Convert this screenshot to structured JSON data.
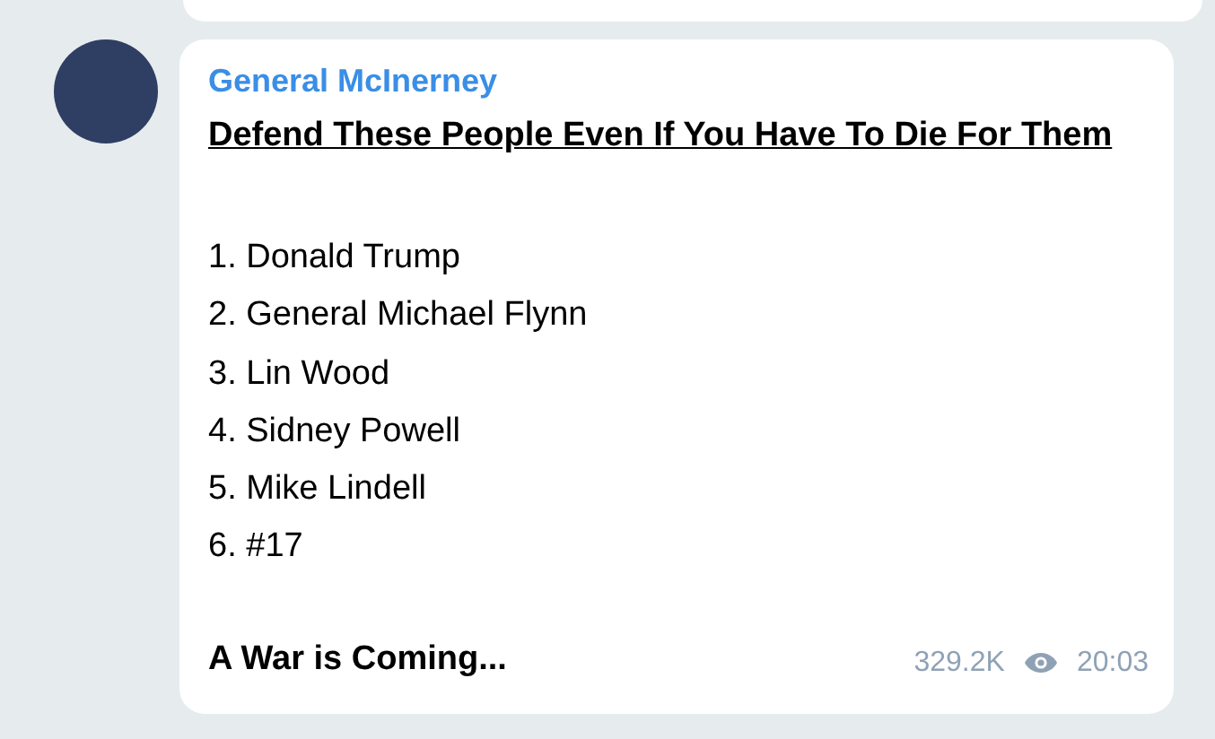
{
  "message": {
    "author": "General McInerney",
    "heading": "Defend These People Even If You Have To Die For Them",
    "list_items": [
      "1. Donald Trump",
      "2. General Michael Flynn",
      "3. Lin Wood",
      "4. Sidney Powell",
      "5. Mike Lindell",
      "6. #17"
    ],
    "closing": "A War is Coming...",
    "views": "329.2K",
    "time": "20:03"
  }
}
